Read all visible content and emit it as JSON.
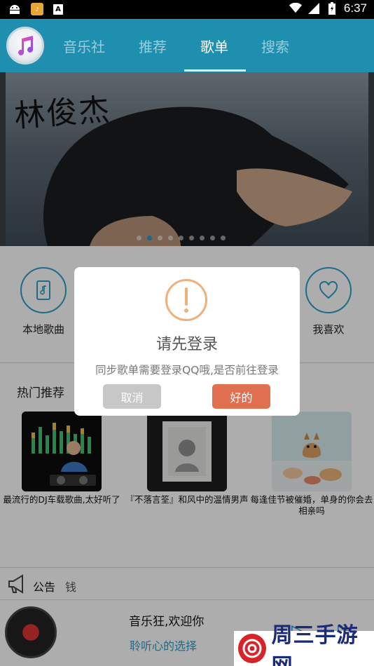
{
  "status_bar": {
    "time": "6:37"
  },
  "header": {
    "tabs": [
      {
        "label": "音乐社"
      },
      {
        "label": "推荐"
      },
      {
        "label": "歌单"
      },
      {
        "label": "搜索"
      }
    ],
    "active_tab": "歌单"
  },
  "banner": {
    "title": "林俊杰",
    "dot_count": 9,
    "active_dot": 1
  },
  "quick_links": [
    {
      "label": "本地歌曲",
      "icon": "phone-music-icon"
    },
    {
      "label": "我喜欢",
      "icon": "heart-icon"
    }
  ],
  "hot": {
    "title": "热门推荐",
    "items": [
      {
        "caption": "最流行的DJ车载歌曲,太好听了"
      },
      {
        "caption": "『不落言筌』和风中的温情男声"
      },
      {
        "caption": "每逢佳节被催婚，单身的你会去相亲吗"
      }
    ]
  },
  "notice": {
    "title": "公告",
    "text": "钱"
  },
  "player": {
    "title": "音乐狂,欢迎你",
    "subtitle": "聆听心的选择"
  },
  "dialog": {
    "title": "请先登录",
    "message": "同步歌单需要登录QQ哦,是否前往登录",
    "cancel_label": "取消",
    "ok_label": "好的"
  },
  "watermark": {
    "text": "周三手游网"
  },
  "colors": {
    "header": "#1f8fb0",
    "accent": "#2b9fc9",
    "ok_button": "#e07050",
    "cancel_button": "#c7c7c7"
  }
}
